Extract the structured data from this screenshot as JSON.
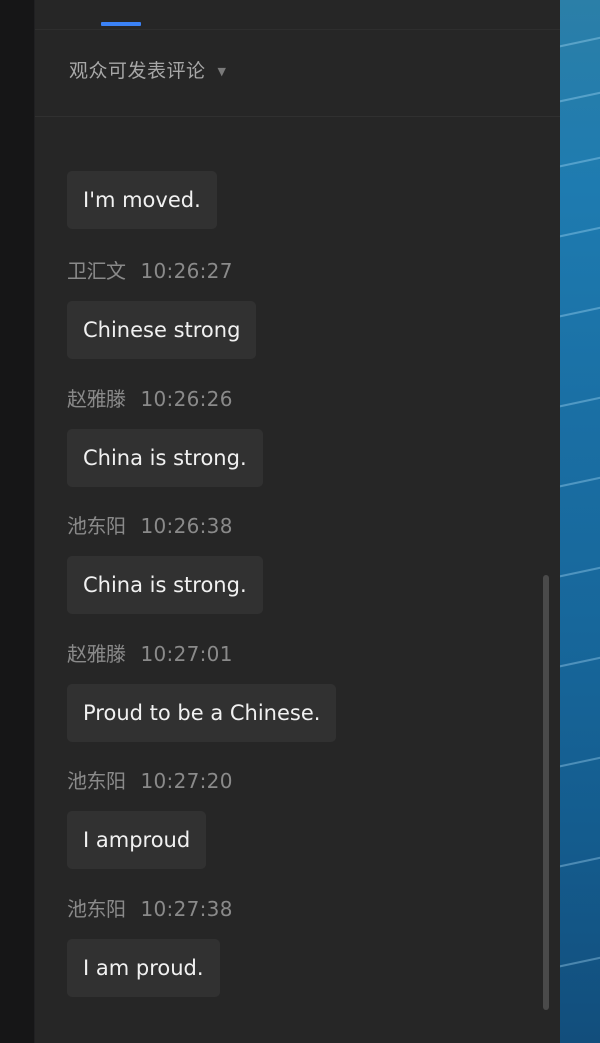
{
  "header": {
    "comment_setting": "观众可发表评论",
    "caret_icon": "caret-down-icon"
  },
  "messages": [
    {
      "name": "",
      "time": "",
      "text": "I'm moved."
    },
    {
      "name": "卫汇文",
      "time": "10:26:27",
      "text": "Chinese  strong"
    },
    {
      "name": "赵雅滕",
      "time": "10:26:26",
      "text": "China  is  strong."
    },
    {
      "name": "池东阳",
      "time": "10:26:38",
      "text": "China is strong."
    },
    {
      "name": "赵雅滕",
      "time": "10:27:01",
      "text": "Proud to be a Chinese."
    },
    {
      "name": "池东阳",
      "time": "10:27:20",
      "text": "I amproud"
    },
    {
      "name": "池东阳",
      "time": "10:27:38",
      "text": "I am proud."
    }
  ],
  "colors": {
    "accent": "#3b82f6",
    "panel_bg": "#262626",
    "bubble_bg": "#313131"
  }
}
